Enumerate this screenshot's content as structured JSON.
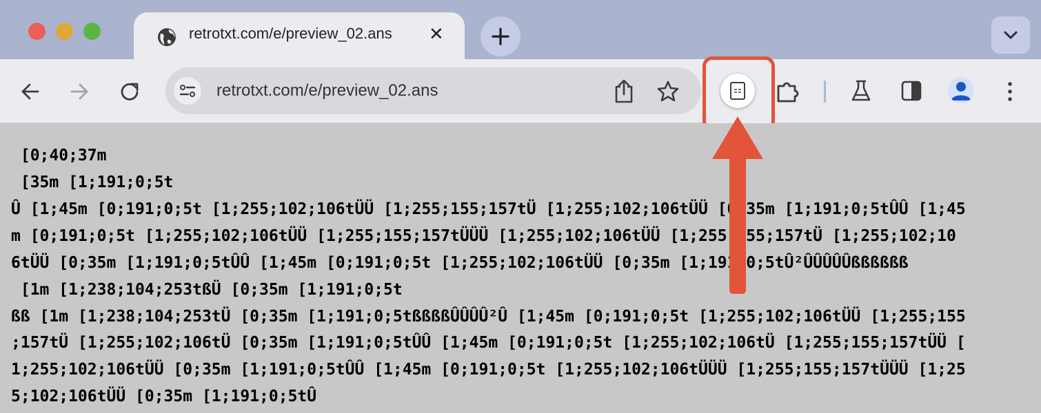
{
  "tab": {
    "title": "retrotxt.com/e/preview_02.ans"
  },
  "address_bar": {
    "url": "retrotxt.com/e/preview_02.ans"
  },
  "icons": {
    "tab_favicon": "globe-icon",
    "tab_close": "close-icon",
    "new_tab": "plus-icon",
    "tab_search": "chevron-down-icon",
    "back": "arrow-left-icon",
    "forward": "arrow-right-icon",
    "reload": "reload-icon",
    "site_info": "tune-icon",
    "share": "share-icon",
    "bookmark": "star-icon",
    "reader_mode": "reader-mode-icon",
    "extensions": "puzzle-icon",
    "labs": "flask-icon",
    "side_panel": "side-panel-icon",
    "profile": "avatar-icon",
    "menu": "kebab-menu-icon"
  },
  "colors": {
    "traffic_close": "#ec5f56",
    "traffic_minimize": "#dfa63a",
    "traffic_zoom": "#5ab643",
    "highlight_border": "#e2553a",
    "arrow": "#e2553a",
    "profile": "#1a56c9"
  },
  "content": {
    "lines": [
      " [0;40;37m",
      " [35m [1;191;0;5t",
      "Û [1;45m [0;191;0;5t [1;255;102;106tÜÜ [1;255;155;157tÜ [1;255;102;106tÜÜ [0;35m [1;191;0;5tÛÛ [1;45",
      "m [0;191;0;5t [1;255;102;106tÜÜ [1;255;155;157tÜÜÜ [1;255;102;106tÜÜ [1;255;155;157tÜ [1;255;102;10",
      "6tÜÜ [0;35m [1;191;0;5tÛÛ [1;45m [0;191;0;5t [1;255;102;106tÜÜ [0;35m [1;191;0;5tÛ²ÛÛÛÛÛßßßßßß",
      " [1m [1;238;104;253tßÜ [0;35m [1;191;0;5t",
      "ßß [1m [1;238;104;253tÜ [0;35m [1;191;0;5tßßßßÛÛÛÛ²Û [1;45m [0;191;0;5t [1;255;102;106tÜÜ [1;255;155",
      ";157tÜ [1;255;102;106tÜ [0;35m [1;191;0;5tÛÛ [1;45m [0;191;0;5t [1;255;102;106tÜ [1;255;155;157tÜÜ [",
      "1;255;102;106tÜÜ [0;35m [1;191;0;5tÛÛ [1;45m [0;191;0;5t [1;255;102;106tÜÜÜ [1;255;155;157tÜÜÜ [1;25",
      "5;102;106tÜÜ [0;35m [1;191;0;5tÛ"
    ]
  }
}
